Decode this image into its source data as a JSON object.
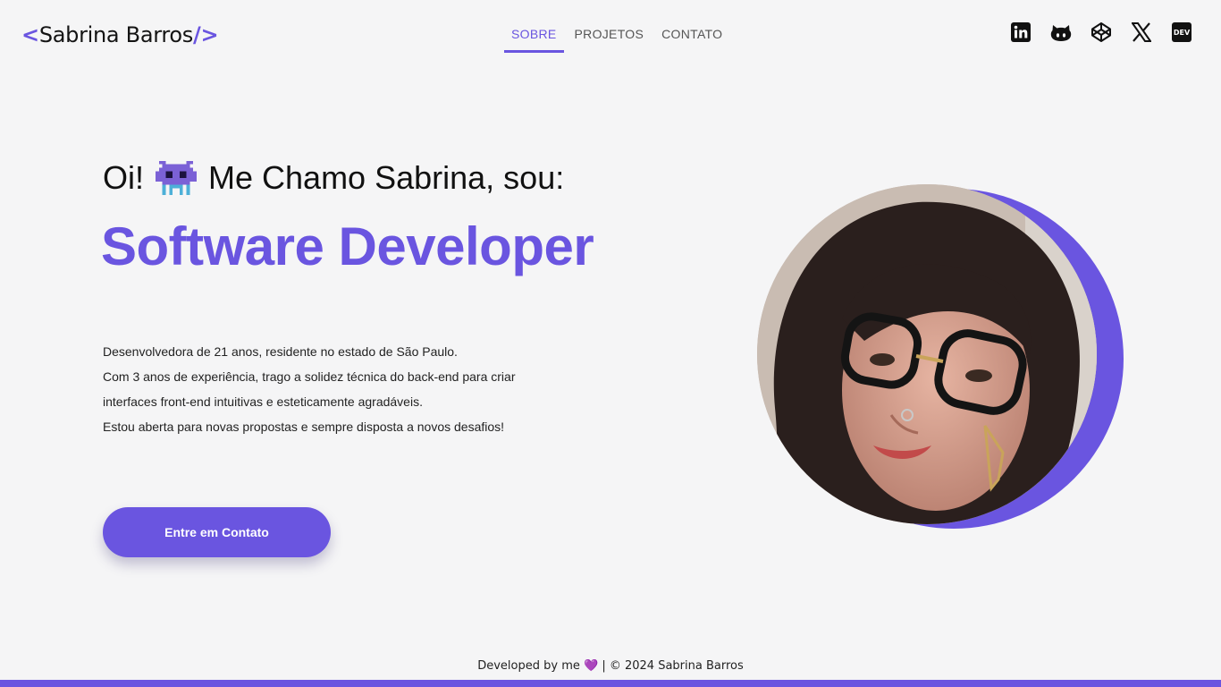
{
  "logo": {
    "open": "<",
    "name": "Sabrina Barros",
    "close": "/>"
  },
  "nav": [
    {
      "label": "SOBRE",
      "active": true
    },
    {
      "label": "PROJETOS",
      "active": false
    },
    {
      "label": "CONTATO",
      "active": false
    }
  ],
  "social": [
    {
      "icon": "linkedin-icon"
    },
    {
      "icon": "github-icon"
    },
    {
      "icon": "codepen-icon"
    },
    {
      "icon": "x-twitter-icon"
    },
    {
      "icon": "dev-icon",
      "label": "DEV"
    }
  ],
  "hero": {
    "greeting_start": "Oi!",
    "greeting_emoji": "alien-monster-emoji",
    "greeting_end": "Me Chamo Sabrina, sou:",
    "role": "Software Developer",
    "bio": [
      "Desenvolvedora de 21 anos, residente no estado de São Paulo.",
      "Com 3 anos de experiência, trago a solidez técnica do back-end para criar",
      "interfaces front-end intuitivas e esteticamente agradáveis.",
      "Estou aberta para novas propostas e sempre disposta a novos desafios!"
    ],
    "cta_label": "Entre em Contato"
  },
  "footer": {
    "left": "Developed by me",
    "heart": "💜",
    "right": "| © 2024 Sabrina Barros"
  },
  "colors": {
    "accent": "#6a55e0",
    "background": "#f5f5f6",
    "text": "#111111"
  }
}
